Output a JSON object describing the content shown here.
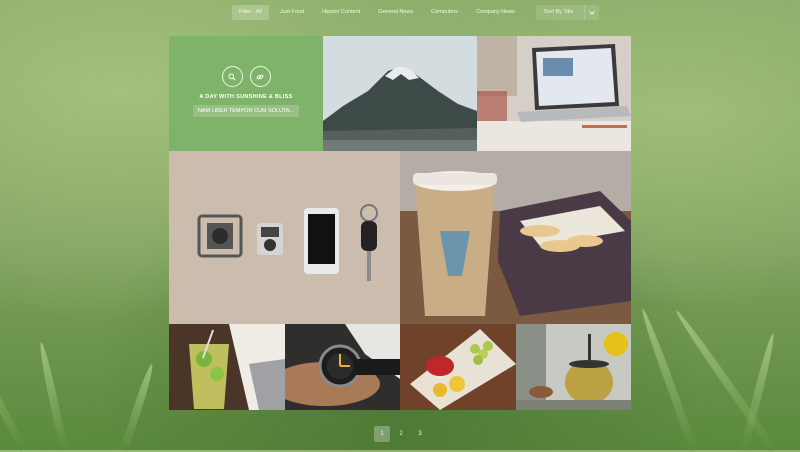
{
  "filters": {
    "items": [
      "Filter - All",
      "Just Food",
      "Hipster Content",
      "General News",
      "Computers",
      "Company News"
    ],
    "active_index": 0,
    "sort_label": "Sort By Title"
  },
  "feature": {
    "title": "A DAY WITH SUNSHINE & BLISS",
    "subtitle": "NAM LIBER TEMPOR CUM SOLUTA..."
  },
  "icons": {
    "search": "search-icon",
    "link": "link-icon",
    "sort_dropdown": "chevron-down-icon"
  },
  "pagination": {
    "pages": [
      "1",
      "2",
      "3"
    ],
    "active_index": 0
  },
  "colors": {
    "feature_tile": "#7fb36a",
    "background": "#7da05c"
  }
}
